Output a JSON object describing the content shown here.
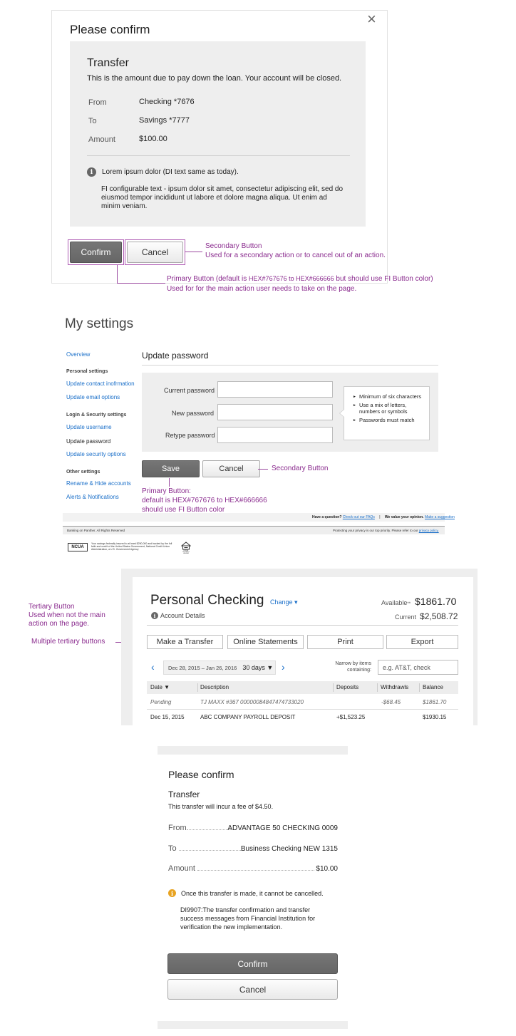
{
  "dialog1": {
    "title": "Please confirm",
    "close": "×",
    "heading": "Transfer",
    "description": "This is the amount due to pay down the loan. Your account will be closed.",
    "rows": [
      {
        "label": "From",
        "value": "Checking *7676"
      },
      {
        "label": "To",
        "value": "Savings *7777"
      },
      {
        "label": "Amount",
        "value": "$100.00"
      }
    ],
    "notice": "Lorem ipsum dolor (DI text same as today).",
    "fi_text": "FI configurable text  - ipsum dolor sit amet, consectetur adipiscing elit, sed do eiusmod tempor incididunt ut labore et dolore magna aliqua. Ut enim ad minim veniam.",
    "confirm_label": "Confirm",
    "cancel_label": "Cancel"
  },
  "annot1": {
    "secondary_title": "Secondary Button",
    "secondary_desc": "Used for a secondary action or to cancel out of an action.",
    "primary_title_a": "Primary Button (default is ",
    "primary_title_b": "HEX#767676 to HEX#666666",
    "primary_title_c": "  but should use FI Button color)",
    "primary_desc": "Used for for the main action user needs to take on the page."
  },
  "settings": {
    "title": "My settings",
    "sidebar": {
      "overview": "Overview",
      "personal_heading": "Personal settings",
      "contact": "Update contact inofrmation",
      "email": "Update email options",
      "login_heading": "Login & Security settings",
      "username": "Update username",
      "password": "Update password",
      "security": "Update security options",
      "other_heading": "Other settings",
      "rename": "Rename & Hide accounts",
      "alerts": "Alerts & Notifications"
    },
    "section_title": "Update password",
    "fields": {
      "current": "Current password",
      "new": "New password",
      "retype": "Retype password"
    },
    "hints": [
      "Minimum of six characters",
      "Use a mix of letters, numbers or symbols",
      "Passwords must match"
    ],
    "save_label": "Save",
    "cancel_label": "Cancel",
    "annot_secondary": "Secondary Button",
    "annot_primary_1": "Primary Button:",
    "annot_primary_2": "default is HEX#767676 to HEX#666666",
    "annot_primary_3": "should use FI Button color",
    "footer": {
      "question": "Have a question?",
      "faqs": "Check out our FAQs",
      "sep": "|",
      "opinion": "We value your opinion.",
      "suggestion": "Make a suggestion",
      "banking": "Banking on Panther. All Rights Reserved",
      "privacy_text": "Protecting your privacy is our top priority. Please refer to our",
      "privacy_link": "privacy policy.",
      "ncua": "NCUA",
      "ncua_text": "Your savings federally insured to at least $250,000 and backed by the full faith and credit of the United States Government, National Credit Union Administration, a U.S. Government Agency",
      "lender": "EQUAL HOUSING LENDER"
    }
  },
  "checking": {
    "annot_tertiary_title": "Tertiary Button",
    "annot_tertiary_desc_1": "Used when not the main",
    "annot_tertiary_desc_2": "action on the page.",
    "annot_multiple": "Multiple tertiary buttons",
    "account_title": "Personal Checking",
    "change": "Change ▾",
    "account_details": "Account Details",
    "available_label": "Available",
    "available_mark": "**",
    "available_value": "$1861.70",
    "current_label": "Current",
    "current_value": "$2,508.72",
    "buttons": [
      "Make a Transfer",
      "Online Statements",
      "Print",
      "Export"
    ],
    "date_range": "Dec 28, 2015 – Jan 26, 2016",
    "period": "30 days ▼",
    "narrow_label_1": "Narrow by items",
    "narrow_label_2": "containing:",
    "search_placeholder": "e.g. AT&T, check",
    "columns": [
      "Date ▼",
      "Description",
      "Deposits",
      "Withdrawls",
      "Balance"
    ],
    "rows": [
      {
        "date": "Pending",
        "desc": "TJ MAXX #367 00000084847474733020",
        "deposit": "",
        "withdrawal": "-$68.45",
        "balance": "$1861.70",
        "pending": true
      },
      {
        "date": "Dec 15, 2015",
        "desc": "ABC COMPANY PAYROLL DEPOSIT",
        "deposit": "+$1,523.25",
        "withdrawal": "",
        "balance": "$1930.15",
        "pending": false
      }
    ]
  },
  "dialog2": {
    "title": "Please confirm",
    "heading": "Transfer",
    "fee_text": "This transfer will incur a fee of $4.50.",
    "rows": [
      {
        "label": "From",
        "value": "ADVANTAGE 50 CHECKING 0009"
      },
      {
        "label": "To",
        "value": "Business Checking NEW 1315"
      },
      {
        "label": "Amount",
        "value": "$10.00"
      }
    ],
    "notice": "Once this transfer is made, it cannot be cancelled.",
    "di_text": "DI9907:The transfer confirmation and transfer success messages from Financial Institution for verification the new implementation.",
    "confirm_label": "Confirm",
    "cancel_label": "Cancel"
  }
}
